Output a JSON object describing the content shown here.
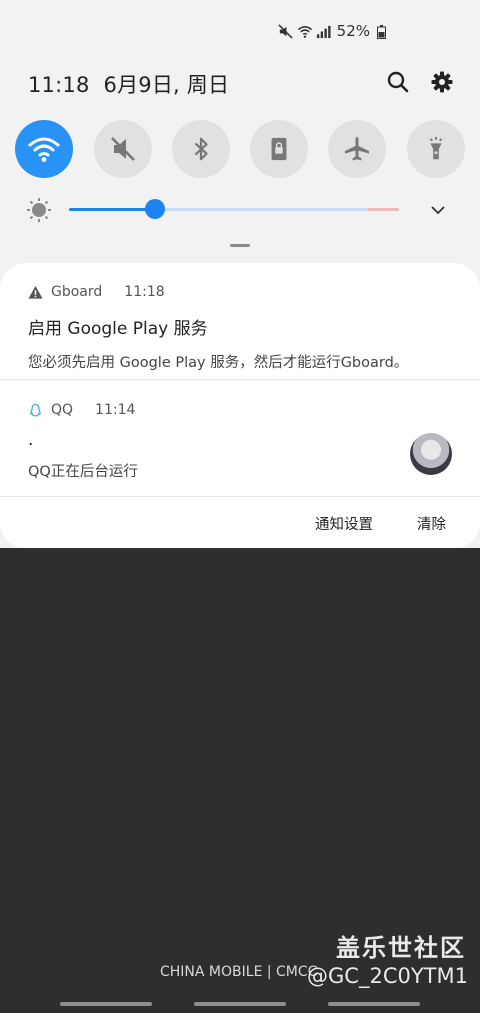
{
  "status_bar": {
    "battery_text": "52%",
    "icons": [
      "mute-icon",
      "wifi-icon",
      "signal-icon",
      "battery-icon"
    ]
  },
  "header": {
    "time": "11:18",
    "date": "6月9日, 周日",
    "icons": [
      "search-icon",
      "gear-icon"
    ]
  },
  "quick_toggles": [
    {
      "icon": "wifi-icon",
      "state": "on"
    },
    {
      "icon": "sound-muted-icon",
      "state": "off"
    },
    {
      "icon": "bluetooth-icon",
      "state": "off"
    },
    {
      "icon": "screen-rotation-lock-icon",
      "state": "off"
    },
    {
      "icon": "airplane-icon",
      "state": "off"
    },
    {
      "icon": "flashlight-icon",
      "state": "off"
    }
  ],
  "brightness": {
    "level": 0.26
  },
  "notifications": [
    {
      "app": "Gboard",
      "time": "11:18",
      "title": "启用 Google Play 服务",
      "body": "您必须先启用 Google Play 服务，然后才能运行Gboard。",
      "icon": "warning-icon"
    },
    {
      "app": "QQ",
      "time": "11:14",
      "title": ".",
      "body": "QQ正在后台运行",
      "icon": "qq-penguin-icon"
    }
  ],
  "actions": {
    "settings_label": "通知设置",
    "clear_label": "清除"
  },
  "carrier": "CHINA MOBILE | CMCC",
  "watermark": {
    "line1": "盖乐世社区",
    "line2": "@GC_2C0YTM1"
  },
  "colors": {
    "accent": "#2993f5",
    "panel_bg": "#f2f2f2",
    "background": "#2e2e2e"
  }
}
